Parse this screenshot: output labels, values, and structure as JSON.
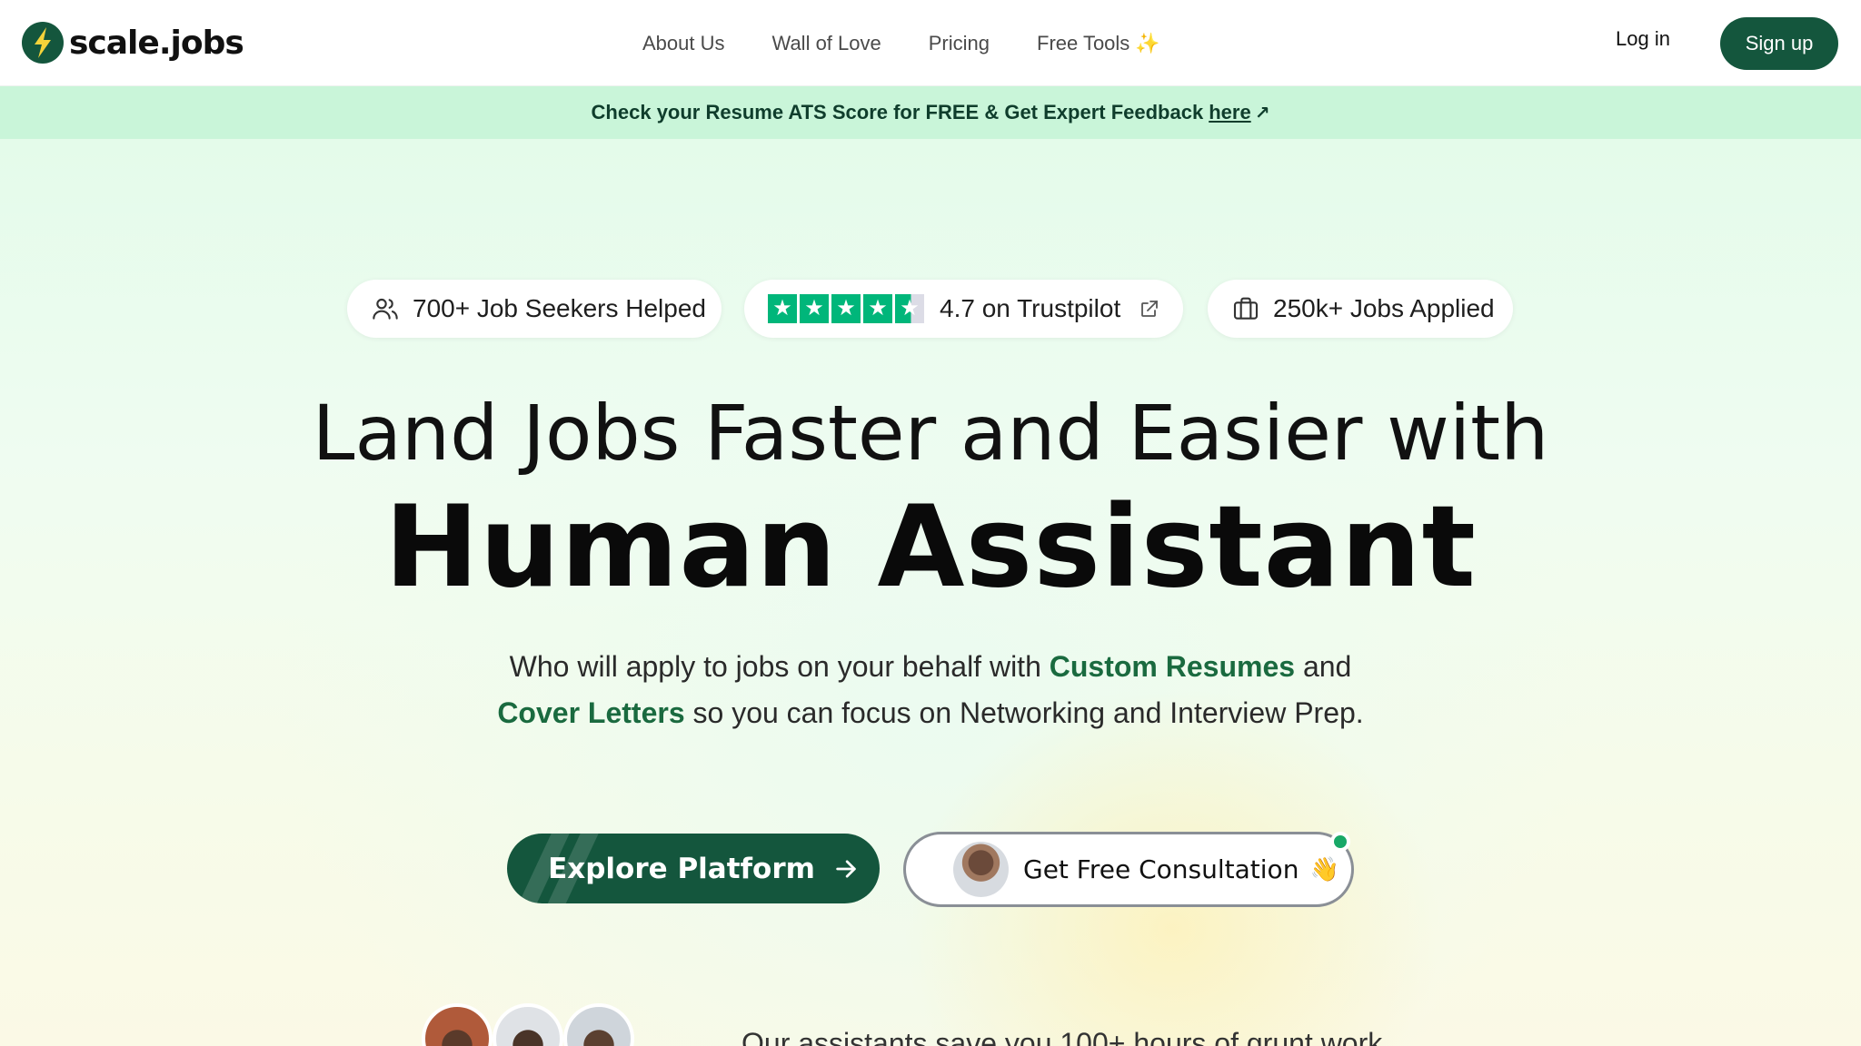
{
  "brand": {
    "name": "scale.jobs",
    "color": "#14563d"
  },
  "nav": {
    "links": [
      "About Us",
      "Wall of Love",
      "Pricing",
      "Free Tools"
    ],
    "free_tools_sparkle": "✨",
    "login": "Log in",
    "signup": "Sign up"
  },
  "banner": {
    "text": "Check your Resume ATS Score for FREE & Get Expert Feedback",
    "link": "here",
    "arrow": "↗",
    "bg": "#c9f5d9"
  },
  "badges": {
    "seekers": "700+ Job Seekers Helped",
    "trustpilot": "4.7 on Trustpilot",
    "rating": 4.7,
    "jobs": "250k+ Jobs Applied"
  },
  "hero": {
    "line1": "Land Jobs Faster and Easier with",
    "line2": "Human Assistant",
    "sub_part1": "Who will apply to jobs on your behalf with",
    "sub_hl1": "Custom Resumes",
    "sub_part2": "and",
    "sub_hl2": "Cover Letters",
    "sub_part3": "so you can focus on Networking and Interview Prep.",
    "accent": "#1a6a3f"
  },
  "cta": {
    "explore": "Explore Platform",
    "consult": "Get Free Consultation",
    "consult_emoji": "👋"
  },
  "social_proof": {
    "text": "Our assistants save you 100+ hours of grunt work"
  }
}
